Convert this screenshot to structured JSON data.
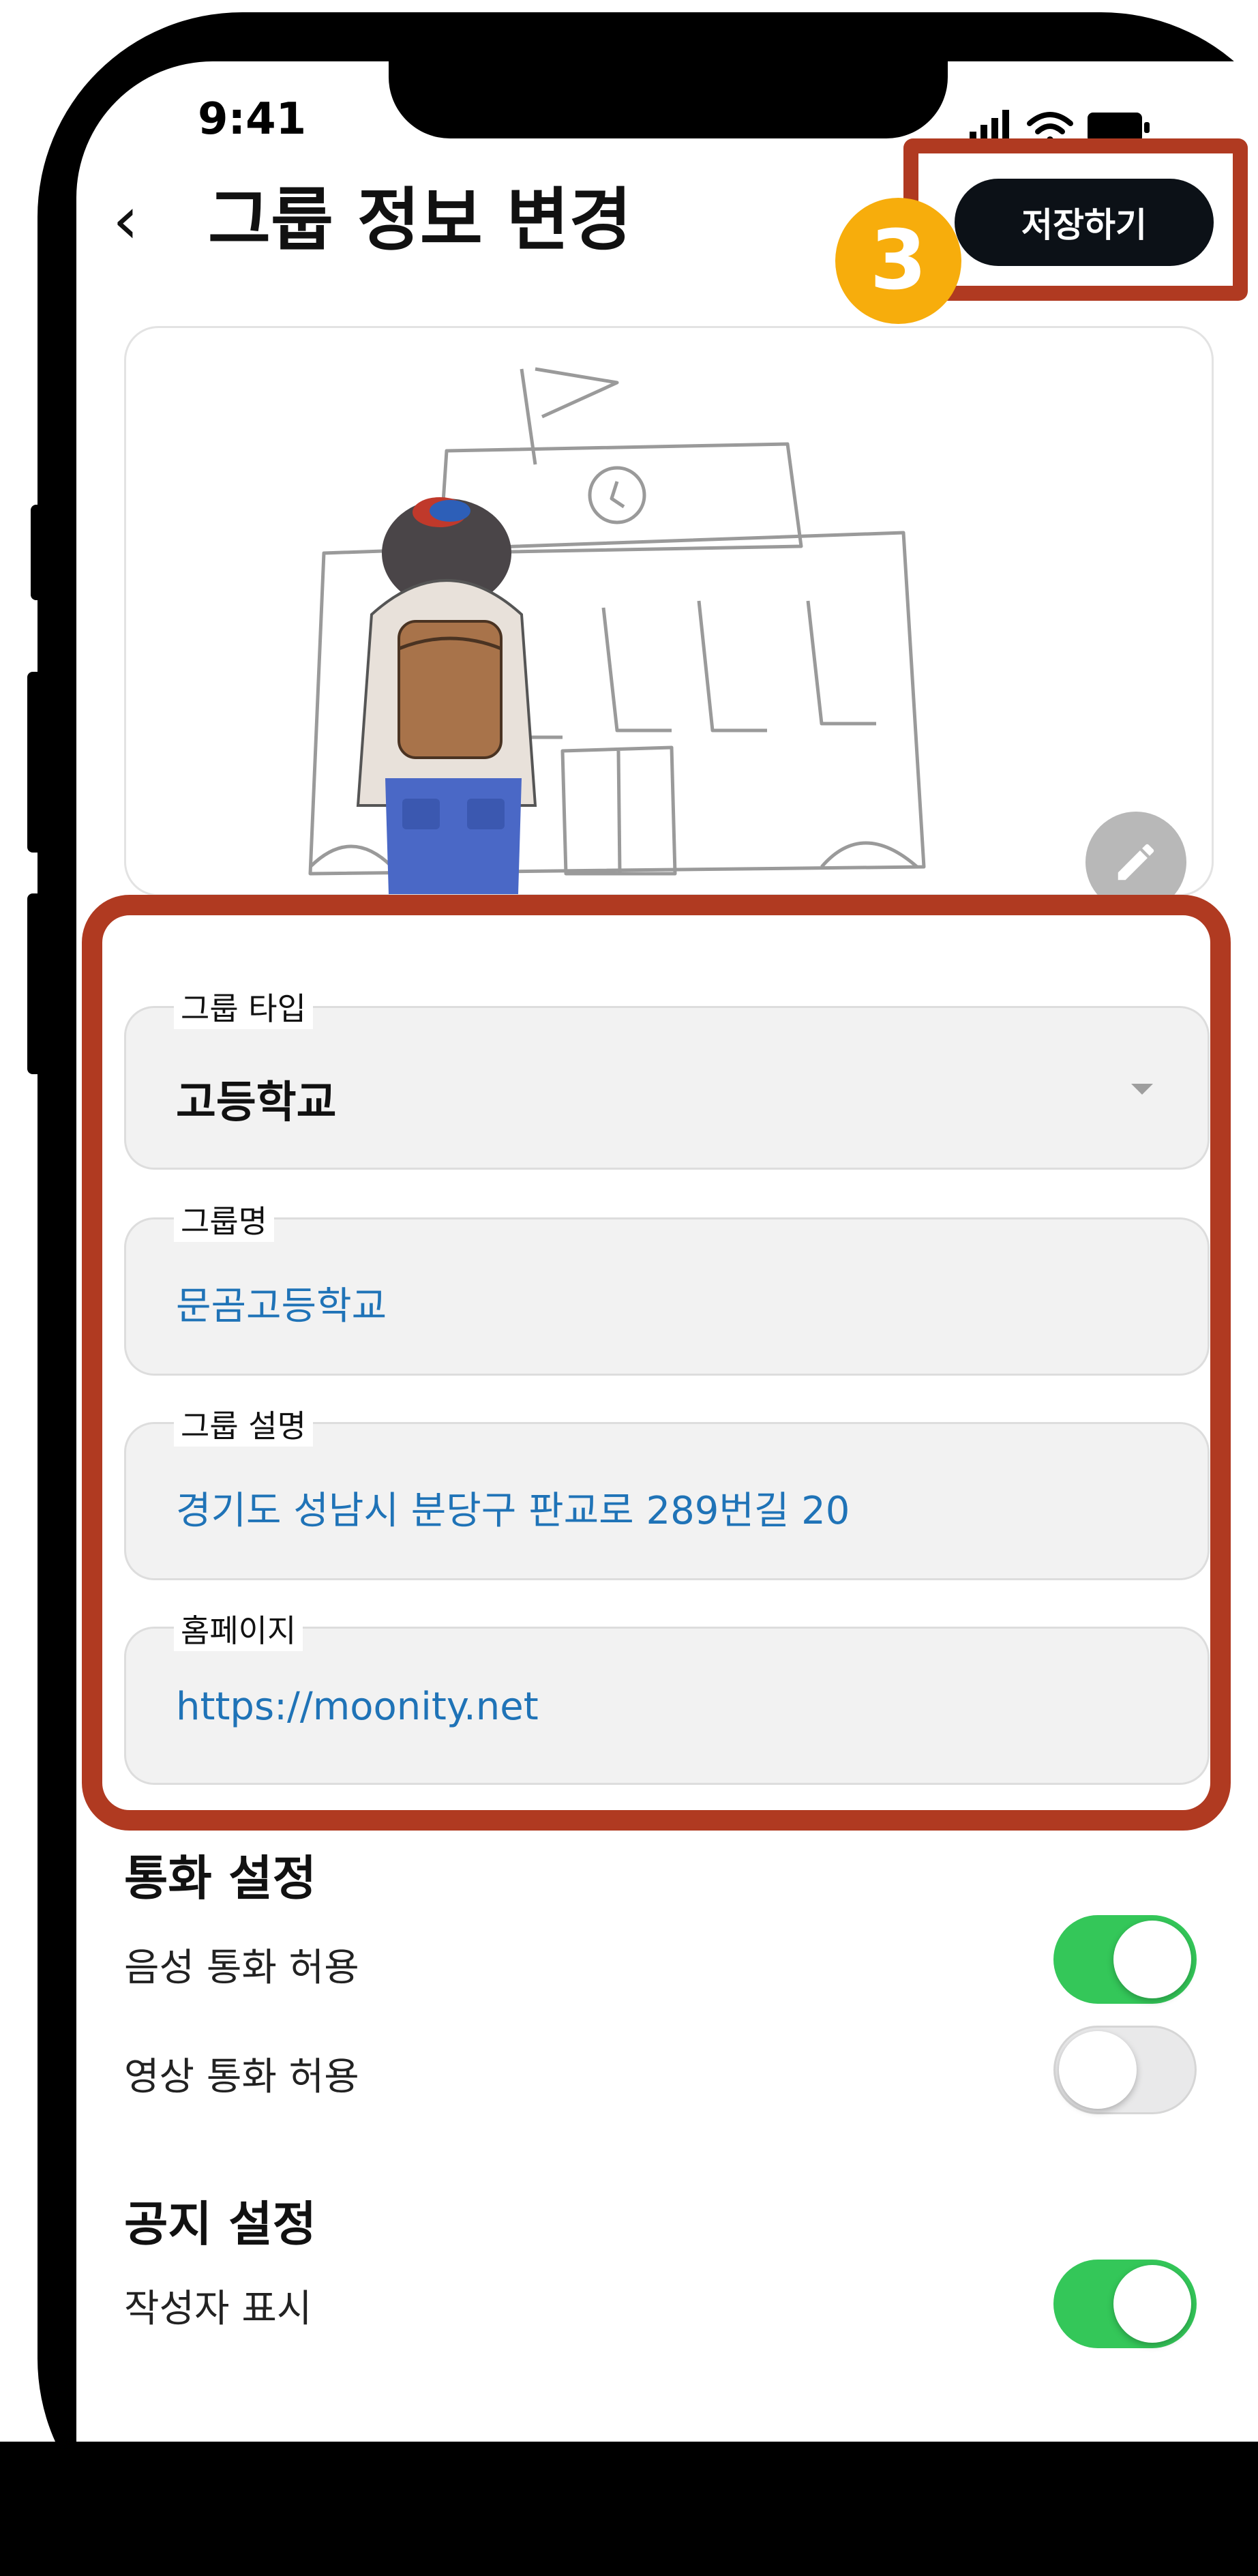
{
  "status_bar": {
    "time": "9:41"
  },
  "header": {
    "back_icon": "chevron-left-icon",
    "title": "그룹 정보 변경",
    "save_label": "저장하기"
  },
  "annotation": {
    "step_number": "3",
    "highlight_color": "#b03a21",
    "badge_color": "#f7ad0c"
  },
  "image": {
    "edit_icon": "pencil-icon"
  },
  "form": {
    "group_type": {
      "label": "그룹 타입",
      "value": "고등학교"
    },
    "group_name": {
      "label": "그룹명",
      "value": "문곰고등학교"
    },
    "group_desc": {
      "label": "그룹 설명",
      "value": "경기도 성남시 분당구 판교로 289번길 20"
    },
    "homepage": {
      "label": "홈페이지",
      "value": "https://moonity.net"
    }
  },
  "call_settings": {
    "title": "통화 설정",
    "voice": {
      "label": "음성 통화 허용",
      "enabled": true
    },
    "video": {
      "label": "영상 통화 허용",
      "enabled": false
    }
  },
  "notice_settings": {
    "title": "공지 설정",
    "author": {
      "label": "작성자 표시",
      "enabled": true
    }
  },
  "colors": {
    "accent_text": "#1f73b7",
    "toggle_on": "#34c759",
    "button_dark": "#0c1117"
  }
}
